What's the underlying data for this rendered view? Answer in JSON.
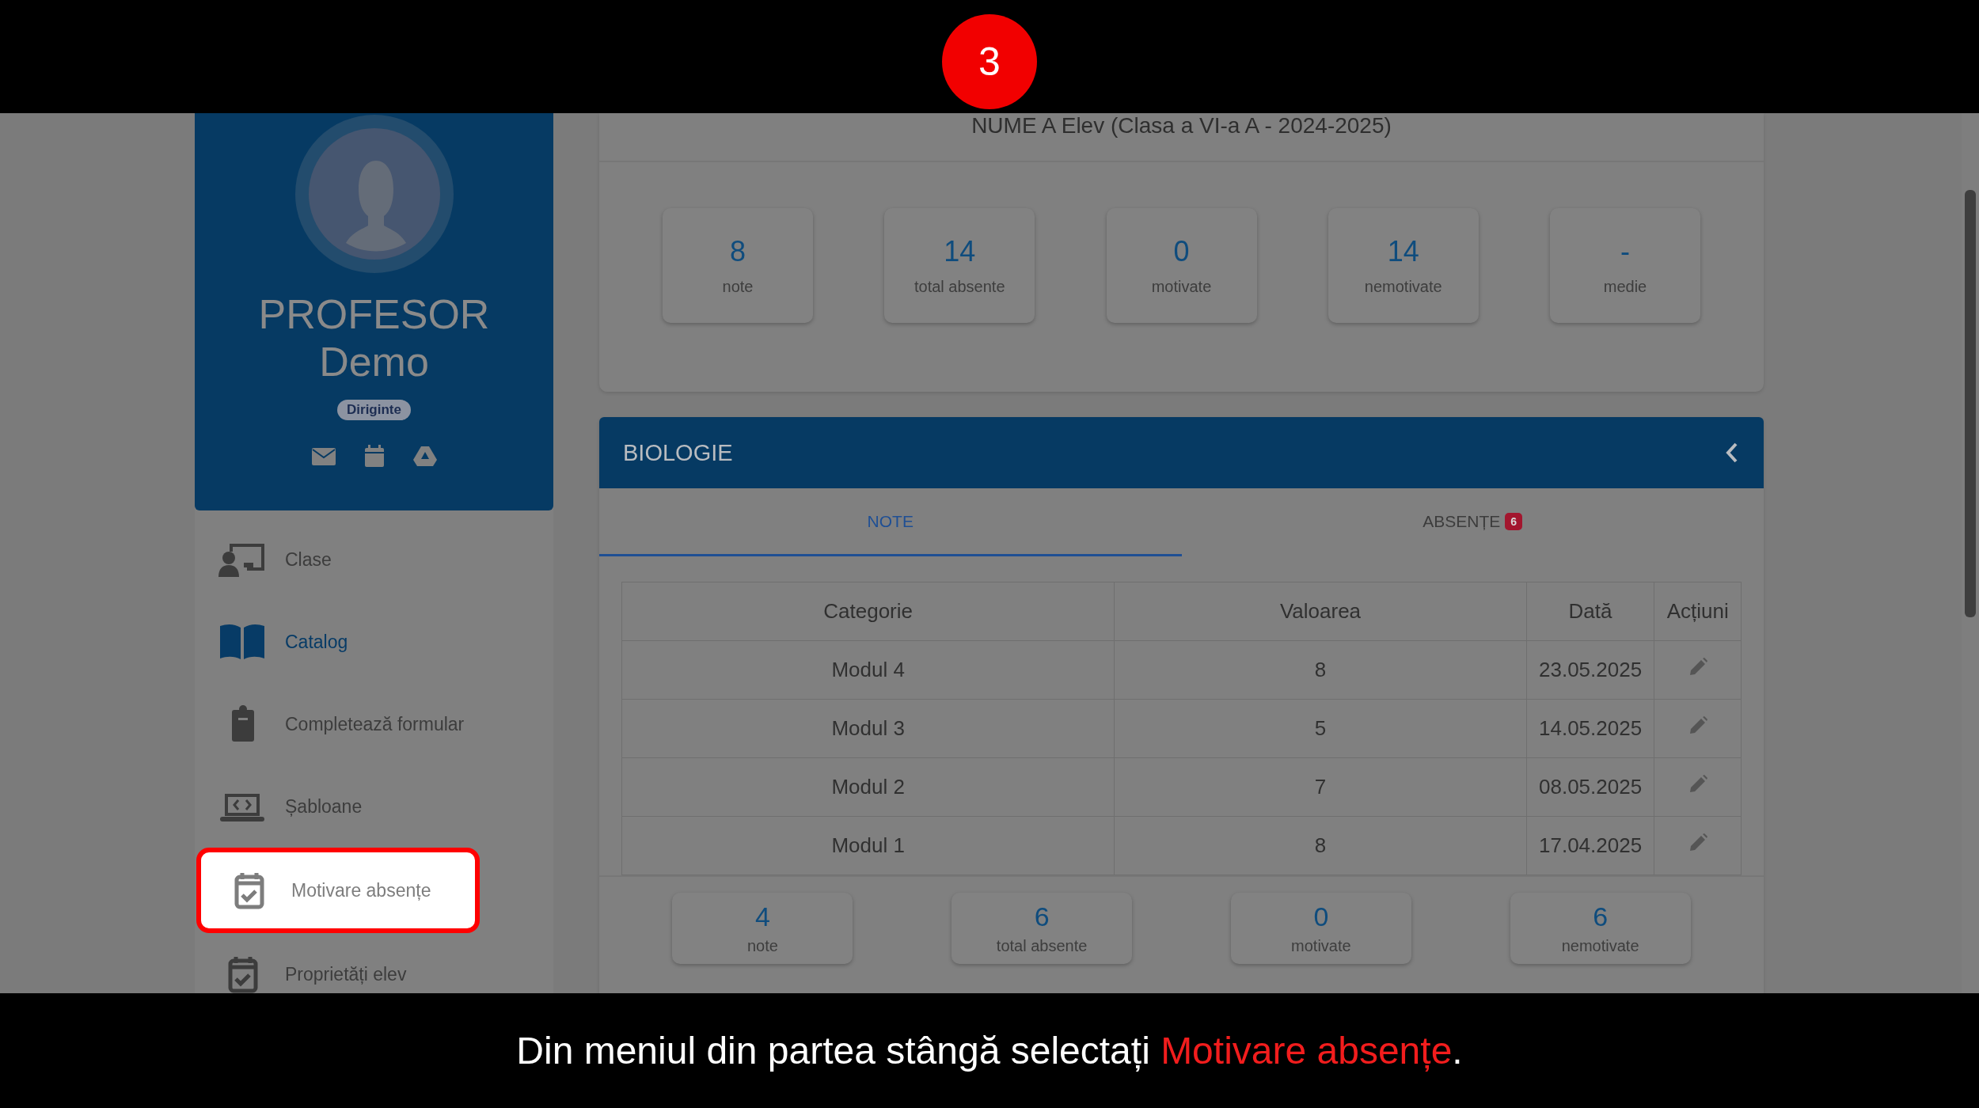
{
  "step_badge": "3",
  "profile": {
    "name_line_1": "PROFESOR",
    "name_line_2": "Demo",
    "role_badge": "Diriginte"
  },
  "sidebar": {
    "items": [
      {
        "label": "Clase",
        "kind": "classes",
        "selected": false,
        "highlighted": false
      },
      {
        "label": "Catalog",
        "kind": "book",
        "selected": true,
        "highlighted": false
      },
      {
        "label": "Completează formular",
        "kind": "clipboard",
        "selected": false,
        "highlighted": false
      },
      {
        "label": "Șabloane",
        "kind": "laptop",
        "selected": false,
        "highlighted": false
      },
      {
        "label": "Motivare absențe",
        "kind": "calendar",
        "selected": false,
        "highlighted": true
      },
      {
        "label": "Proprietăți elev",
        "kind": "calendar",
        "selected": false,
        "highlighted": false
      }
    ]
  },
  "student_header": {
    "title": "NUME A Elev (Clasa a VI-a A - 2024-2025)",
    "stats": [
      {
        "value": "8",
        "label": "note"
      },
      {
        "value": "14",
        "label": "total absente"
      },
      {
        "value": "0",
        "label": "motivate"
      },
      {
        "value": "14",
        "label": "nemotivate"
      },
      {
        "value": "-",
        "label": "medie"
      }
    ]
  },
  "subject_panel": {
    "title": "BIOLOGIE",
    "tabs": [
      {
        "label": "NOTE",
        "selected": true
      },
      {
        "label": "ABSENȚE",
        "badge": "6",
        "selected": false
      }
    ],
    "table": {
      "columns": [
        "Categorie",
        "Valoarea",
        "Dată",
        "Acțiuni"
      ],
      "rows": [
        {
          "category": "Modul 4",
          "value": "8",
          "date": "23.05.2025"
        },
        {
          "category": "Modul 3",
          "value": "5",
          "date": "14.05.2025"
        },
        {
          "category": "Modul 2",
          "value": "7",
          "date": "08.05.2025"
        },
        {
          "category": "Modul 1",
          "value": "8",
          "date": "17.04.2025"
        }
      ]
    },
    "stats": [
      {
        "value": "4",
        "label": "note"
      },
      {
        "value": "6",
        "label": "total absente"
      },
      {
        "value": "0",
        "label": "motivate"
      },
      {
        "value": "6",
        "label": "nemotivate"
      }
    ]
  },
  "caption": [
    {
      "text": "Din meniul din partea stângă selectați ",
      "highlighted": false
    },
    {
      "text": "Motivare absențe",
      "highlighted": true
    },
    {
      "text": ".",
      "highlighted": false
    }
  ]
}
